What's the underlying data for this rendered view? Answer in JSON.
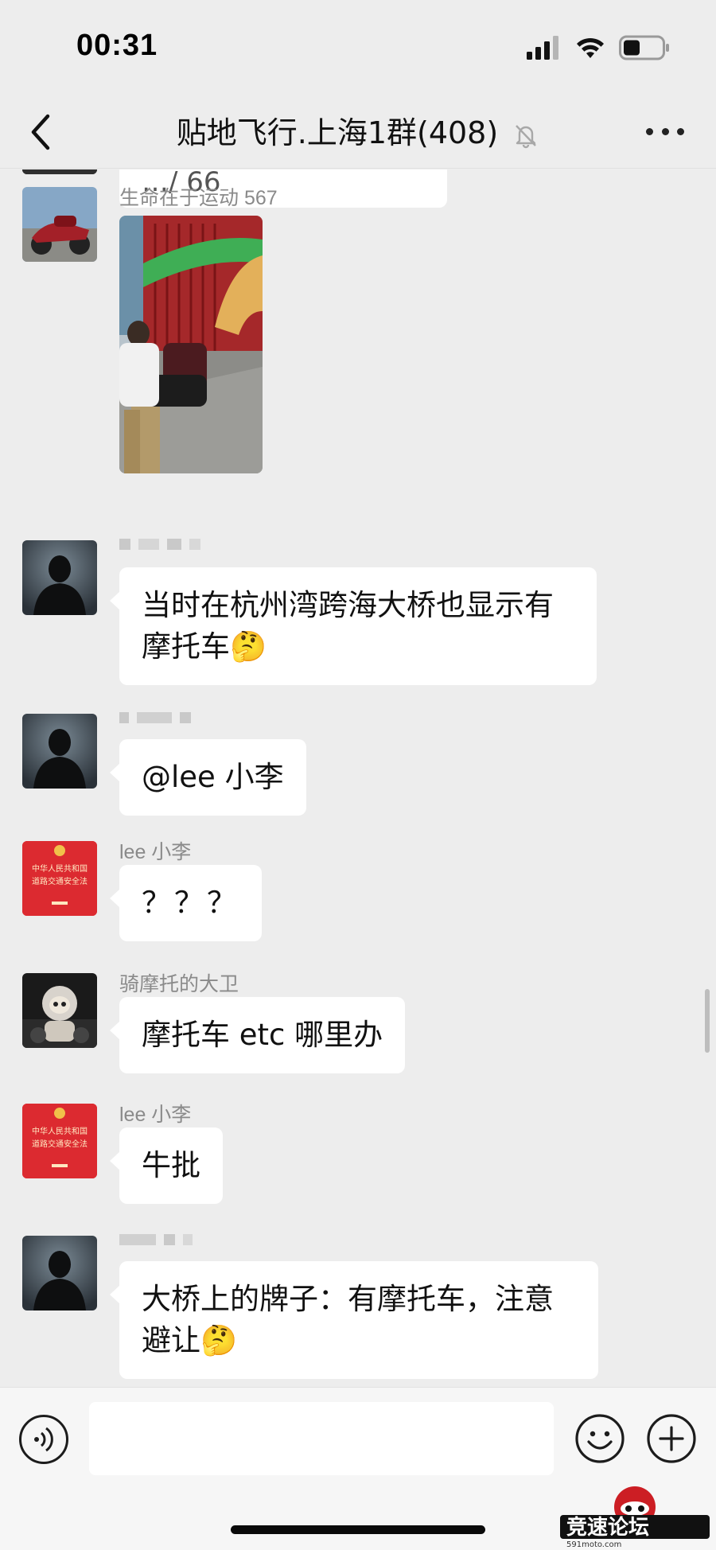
{
  "status_bar": {
    "time": "00:31"
  },
  "nav": {
    "title": "贴地飞行.上海1群(408)"
  },
  "messages": [
    {
      "id": "m0",
      "text": "…/ 66"
    },
    {
      "id": "m1",
      "sender": "生命在于运动 567"
    },
    {
      "id": "m2",
      "text_line1": "当时在杭州湾跨海大桥也显示有",
      "text_line2": "摩托车🤔"
    },
    {
      "id": "m3",
      "text": "@lee 小李"
    },
    {
      "id": "m4",
      "sender": "lee 小李",
      "text": "？？？"
    },
    {
      "id": "m5",
      "sender": "骑摩托的大卫",
      "text": "摩托车 etc 哪里办"
    },
    {
      "id": "m6",
      "sender": "lee 小李",
      "text": "牛批"
    },
    {
      "id": "m7",
      "text_line1": "大桥上的牌子：有摩托车，注意",
      "text_line2": "避让🤔"
    }
  ],
  "avatars": {
    "law_book_line1": "中华人民共和国",
    "law_book_line2": "道路交通安全法"
  },
  "watermark": {
    "text": "竞速论坛",
    "url": "591moto.com"
  },
  "colors": {
    "bg": "#ededed",
    "bubble": "#ffffff",
    "sender": "#8a8a8a",
    "accent_red": "#d42b2b"
  }
}
